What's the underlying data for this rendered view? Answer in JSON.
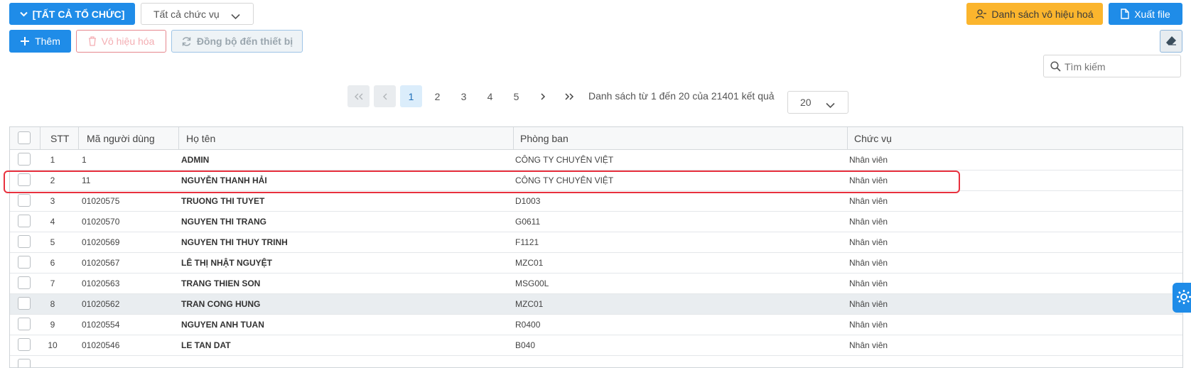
{
  "toolbar": {
    "org_filter_label": "[TẤT CẢ TỔ CHỨC]",
    "position_filter_value": "Tất cả chức vụ",
    "disabled_list_label": "Danh sách vô hiệu hoá",
    "export_label": "Xuất file",
    "add_label": "Thêm",
    "disable_label": "Vô hiệu hóa",
    "sync_label": "Đồng bộ đến thiết bị"
  },
  "search": {
    "placeholder": "Tìm kiếm"
  },
  "pagination": {
    "pages": [
      "1",
      "2",
      "3",
      "4",
      "5"
    ],
    "current": "1",
    "summary": "Danh sách từ 1 đến 20 của 21401 kết quả",
    "page_size": "20"
  },
  "table": {
    "columns": {
      "stt": "STT",
      "user_code": "Mã người dùng",
      "full_name": "Họ tên",
      "department": "Phòng ban",
      "position": "Chức vụ"
    },
    "rows": [
      {
        "stt": "1",
        "code": "1",
        "name": "ADMIN",
        "dept": "CÔNG TY CHUYÊN VIỆT",
        "position": "Nhân viên"
      },
      {
        "stt": "2",
        "code": "11",
        "name": "NGUYỄN THANH HẢI",
        "dept": "CÔNG TY CHUYÊN VIỆT",
        "position": "Nhân viên"
      },
      {
        "stt": "3",
        "code": "01020575",
        "name": "TRUONG THI TUYET",
        "dept": "D1003",
        "position": "Nhân viên"
      },
      {
        "stt": "4",
        "code": "01020570",
        "name": "NGUYEN THI TRANG",
        "dept": "G0611",
        "position": "Nhân viên"
      },
      {
        "stt": "5",
        "code": "01020569",
        "name": "NGUYEN THI THUY TRINH",
        "dept": "F1121",
        "position": "Nhân viên"
      },
      {
        "stt": "6",
        "code": "01020567",
        "name": "LÊ THỊ NHẬT NGUYỆT",
        "dept": "MZC01",
        "position": "Nhân viên"
      },
      {
        "stt": "7",
        "code": "01020563",
        "name": "TRANG THIEN SON",
        "dept": "MSG00L",
        "position": "Nhân viên"
      },
      {
        "stt": "8",
        "code": "01020562",
        "name": "TRAN CONG HUNG",
        "dept": "MZC01",
        "position": "Nhân viên"
      },
      {
        "stt": "9",
        "code": "01020554",
        "name": "NGUYEN ANH TUAN",
        "dept": "R0400",
        "position": "Nhân viên"
      },
      {
        "stt": "10",
        "code": "01020546",
        "name": "LE TAN DAT",
        "dept": "B040",
        "position": "Nhân viên"
      }
    ]
  },
  "colors": {
    "primary": "#1f8ce8",
    "warning": "#fbb52d",
    "danger_outline": "#e6878e",
    "highlight_box": "#e8313e"
  }
}
